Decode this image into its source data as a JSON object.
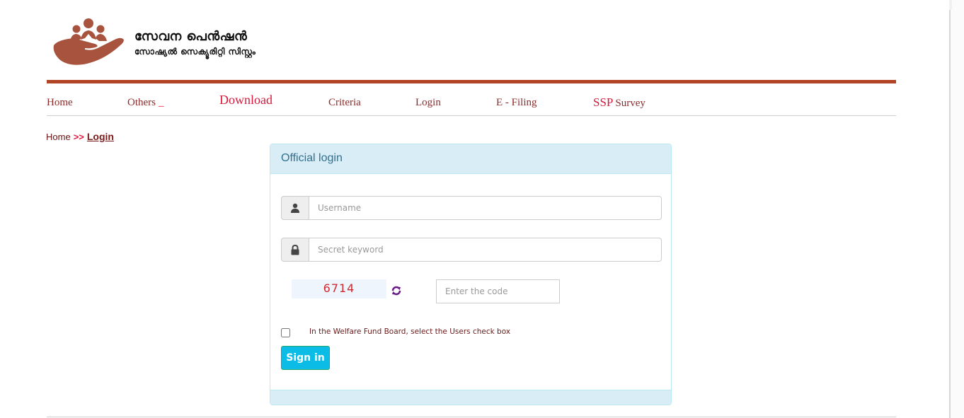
{
  "brand": {
    "title": "സേവന പെൻഷൻ",
    "subtitle": "സോഷ്യൽ സെക്യൂരിറ്റി സിസ്റ്റം",
    "logo_icon": "hand-holding-people-icon",
    "color": "#b04424"
  },
  "nav": {
    "items": [
      {
        "label": "Home"
      },
      {
        "label": "Others",
        "suffix": "_"
      },
      {
        "label": "Download"
      },
      {
        "label": "Criteria"
      },
      {
        "label": "Login"
      },
      {
        "label": "E - Filing"
      },
      {
        "label_prefix": "SSP",
        "label": "Survey"
      }
    ]
  },
  "breadcrumb": {
    "home": "Home",
    "separator": ">>",
    "current": "Login"
  },
  "login_panel": {
    "title": "Official login",
    "username": {
      "value": "",
      "placeholder": "Username",
      "icon": "user-icon"
    },
    "password": {
      "value": "",
      "placeholder": "Secret keyword",
      "icon": "lock-icon"
    },
    "captcha": {
      "code": "6714",
      "refresh_icon": "refresh-icon"
    },
    "code_input": {
      "value": "",
      "placeholder": "Enter the code"
    },
    "checkbox": {
      "checked": false,
      "label": "In the Welfare Fund Board, select the Users check box"
    },
    "submit_label": "Sign in"
  }
}
